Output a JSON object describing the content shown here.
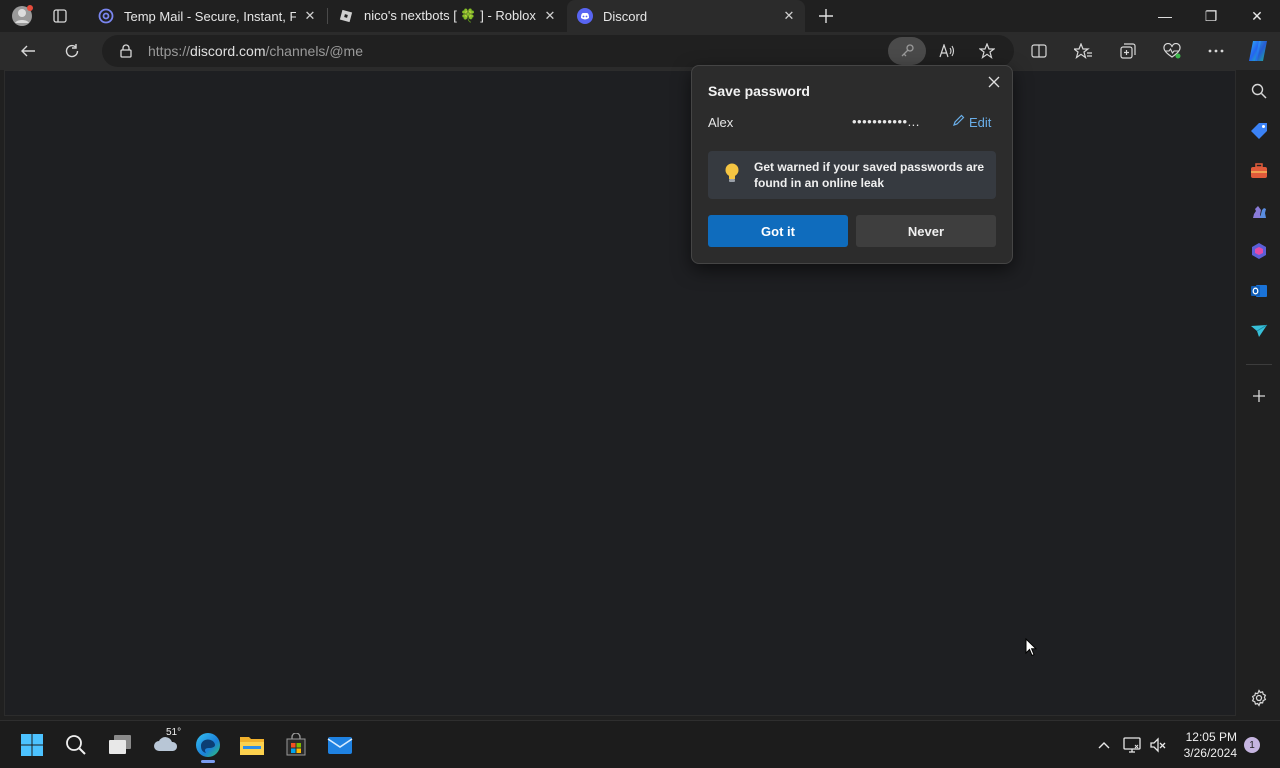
{
  "tabs": [
    {
      "title": "Temp Mail - Secure, Instant, Fast",
      "icon": "at-sign-icon",
      "close": "✕"
    },
    {
      "title": "nico's nextbots [ 🍀 ] - Roblox",
      "icon": "roblox-icon",
      "close": "✕"
    },
    {
      "title": "Discord",
      "icon": "discord-icon",
      "close": "✕",
      "active": true
    }
  ],
  "window_controls": {
    "minimize": "—",
    "restore": "❐",
    "close": "✕"
  },
  "address_bar": {
    "scheme": "https://",
    "host": "discord.com",
    "path": "/channels/@me"
  },
  "save_password_popup": {
    "title": "Save password",
    "username": "Alex",
    "password_mask": "•••••••••••...",
    "edit_label": "Edit",
    "warning_text": "Get warned if your saved passwords are found in an online leak",
    "primary_button": "Got it",
    "secondary_button": "Never"
  },
  "taskbar": {
    "weather_temp": "51°",
    "time": "12:05 PM",
    "date": "3/26/2024",
    "notification_count": "1"
  },
  "colors": {
    "accent_blue": "#0f6cbd",
    "link_blue": "#6aaee8",
    "content_bg": "#1e1f22",
    "discord_blurple": "#5865f2"
  }
}
